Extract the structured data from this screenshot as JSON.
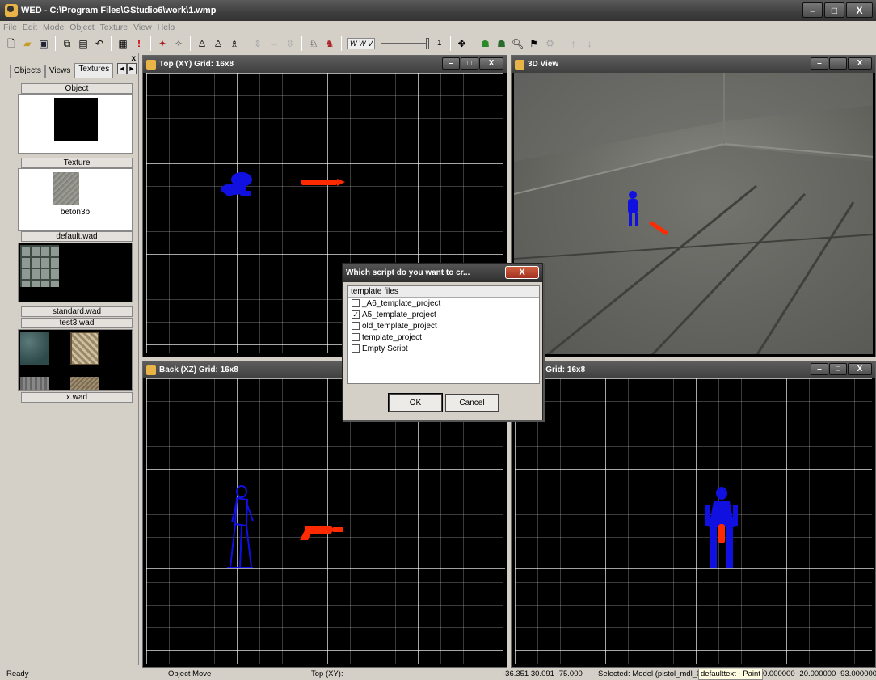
{
  "window": {
    "title": "WED - C:\\Program Files\\GStudio6\\work\\1.wmp",
    "controls": {
      "minimize": "–",
      "maximize": "□",
      "close": "X"
    }
  },
  "menu": [
    "File",
    "Edit",
    "Mode",
    "Object",
    "Texture",
    "View",
    "Help"
  ],
  "toolbar": {
    "icons": [
      "new-file-icon",
      "open-folder-icon",
      "save-icon",
      "copy-icon",
      "paste-icon",
      "undo-icon",
      "film-icon",
      "exclamation-icon",
      "move-object-icon",
      "rotate-object-icon",
      "add-object-icon",
      "add-light-icon",
      "add-sound-icon",
      "scale-icon",
      "mirror-icon",
      "flip-icon",
      "load-icon",
      "save-model-icon"
    ],
    "checkbox_label": "W W V",
    "slider_value": "1",
    "right_icons": [
      "crosshair-icon",
      "build-icon",
      "run-icon",
      "zoom-icon",
      "flag-icon",
      "settings-icon",
      "sort-asc-icon",
      "sort-desc-icon"
    ]
  },
  "left_panel": {
    "close": "x",
    "tabs": [
      "Objects",
      "Views",
      "Textures"
    ],
    "object_caption": "Object",
    "texture_caption": "Texture",
    "texture_name": "beton3b",
    "wads": [
      "default.wad",
      "standard.wad",
      "test3.wad",
      "x.wad"
    ]
  },
  "viewports": {
    "top": {
      "title": "Top (XY) Grid: 16x8"
    },
    "view3d": {
      "title": "3D View"
    },
    "back": {
      "title": "Back (XZ) Grid: 16x8"
    },
    "side": {
      "title": "(YZ) Grid: 16x8"
    }
  },
  "dialog": {
    "title": "Which script do you want to cr...",
    "close": "X",
    "list_header": "template files",
    "items": [
      {
        "label": "_A6_template_project",
        "checked": false
      },
      {
        "label": "A5_template_project",
        "checked": true
      },
      {
        "label": "old_template_project",
        "checked": false
      },
      {
        "label": "template_project",
        "checked": false
      },
      {
        "label": "Empty Script",
        "checked": false
      }
    ],
    "ok": "OK",
    "cancel": "Cancel"
  },
  "status": {
    "ready": "Ready",
    "mode": "Object Move",
    "view": "Top (XY):",
    "coords": "-36.351 30.091 -75.000",
    "selected": "Selected: Model (pistol_mdl_00",
    "paint": "defaulttext - Paint",
    "position": "0.000000 -20.000000 -93.000000"
  },
  "colors": {
    "player": "#1010e0",
    "weapon": "#ff2a00"
  }
}
